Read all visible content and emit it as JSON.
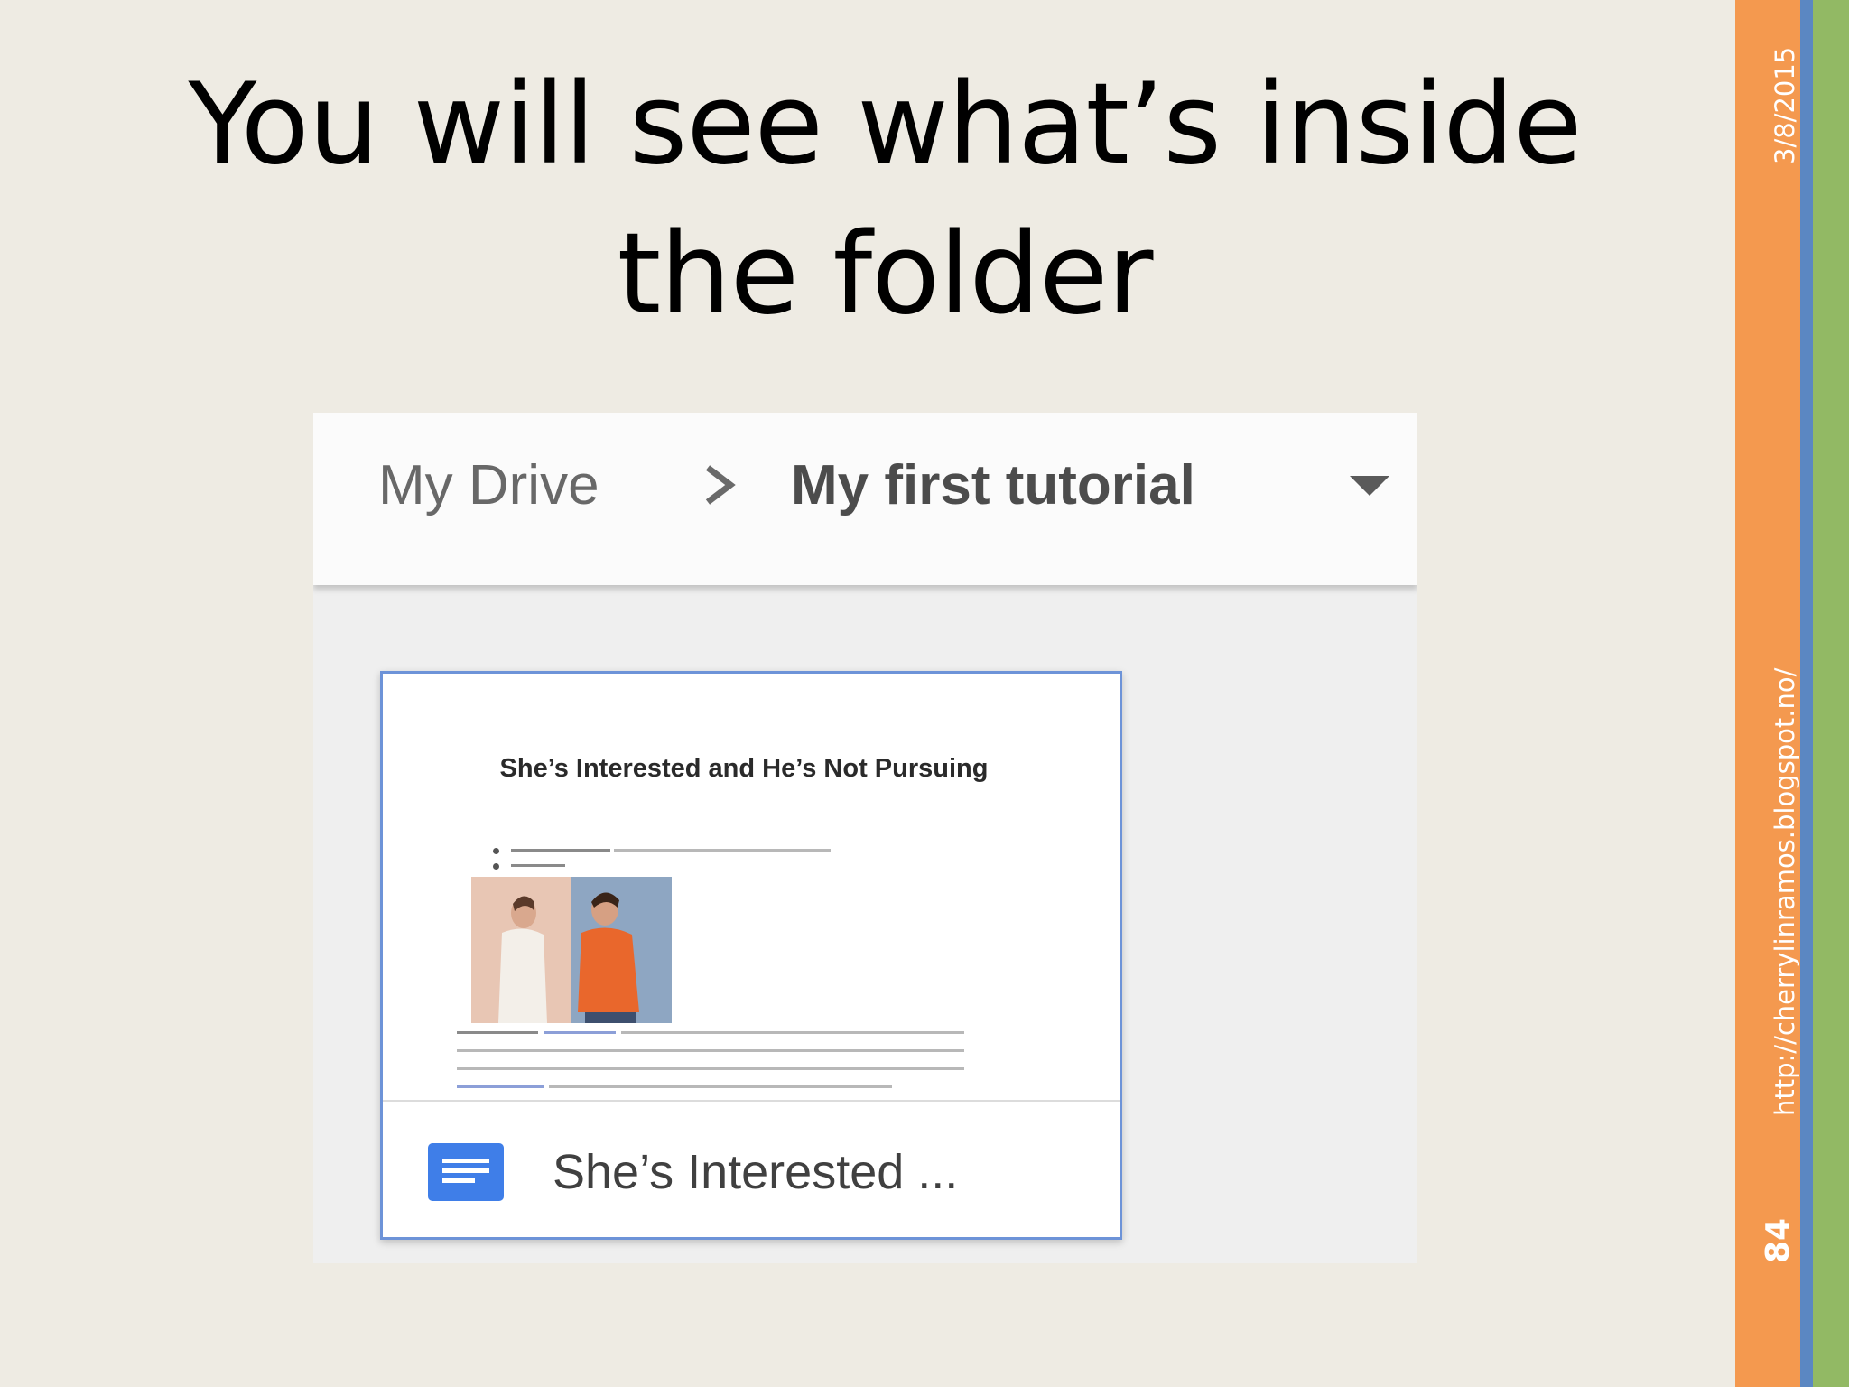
{
  "slide": {
    "title": "You will see what’s inside the folder",
    "date": "3/8/2015",
    "url": "http://cherrylinramos.blogspot.no/",
    "page_number": "84",
    "colors": {
      "background": "#eeebe3",
      "orange": "#f4994f",
      "blue": "#5b87c2",
      "green": "#92b964"
    }
  },
  "drive": {
    "breadcrumb": {
      "root": "My Drive",
      "current": "My first tutorial"
    },
    "icons": {
      "separator": "chevron-right-icon",
      "dropdown": "caret-down-icon",
      "file_type": "google-docs-icon"
    },
    "file": {
      "name": "She’s Interested ...",
      "preview_title": "She’s Interested and He’s Not Pursuing"
    }
  }
}
